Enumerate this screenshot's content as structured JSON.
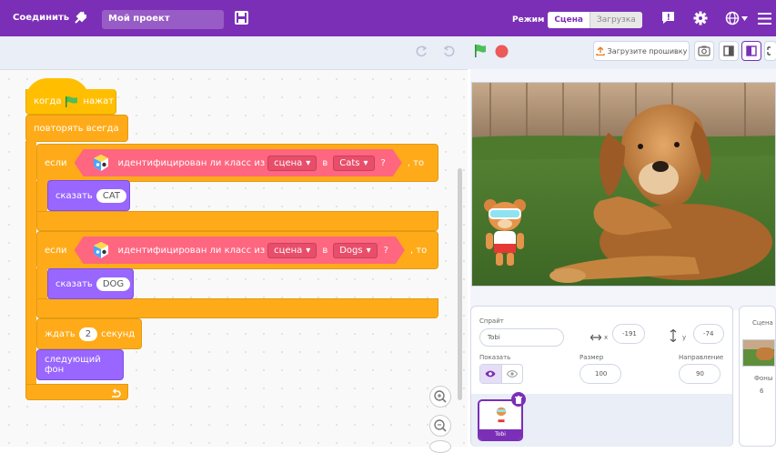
{
  "menubar": {
    "connect_label": "Соединить",
    "project_name": "Мой проект",
    "mode_label": "Режим",
    "mode_options": [
      "Сцена",
      "Загрузка"
    ]
  },
  "toolbar": {
    "upload_label": "Загрузите прошивку"
  },
  "script": {
    "event_when": "когда",
    "event_clicked": "нажат",
    "forever": "повторять всегда",
    "if1": {
      "if": "если",
      "text": "идентифицирован ли класс из",
      "source": "сцена",
      "in": "в",
      "class": "Cats",
      "q": "?",
      "then": ", то"
    },
    "say1": {
      "label": "сказать",
      "value": "CAT"
    },
    "if2": {
      "if": "если",
      "text": "идентифицирован ли класс из",
      "source": "сцена",
      "in": "в",
      "class": "Dogs",
      "q": "?",
      "then": ", то"
    },
    "say2": {
      "label": "сказать",
      "value": "DOG"
    },
    "wait": {
      "label": "ждать",
      "value": "2",
      "unit": "секунд"
    },
    "next_backdrop": "следующий фон"
  },
  "sprite_info": {
    "sprite_label": "Спрайт",
    "sprite_name": "Tobi",
    "x_label": "x",
    "x_value": "-191",
    "y_label": "y",
    "y_value": "-74",
    "show_label": "Показать",
    "size_label": "Размер",
    "size_value": "100",
    "direction_label": "Направление",
    "direction_value": "90",
    "thumb_name": "Tobi"
  },
  "stage_panel": {
    "title": "Сцена",
    "backdrops_label": "Фоны",
    "backdrops_count": "6"
  },
  "colors": {
    "menubar": "#7b2fb6",
    "control": "#ffab19",
    "looks": "#9966ff",
    "ml_extension": "#ff6680",
    "green_flag": "#4cbf56",
    "stop": "#ec5959"
  }
}
